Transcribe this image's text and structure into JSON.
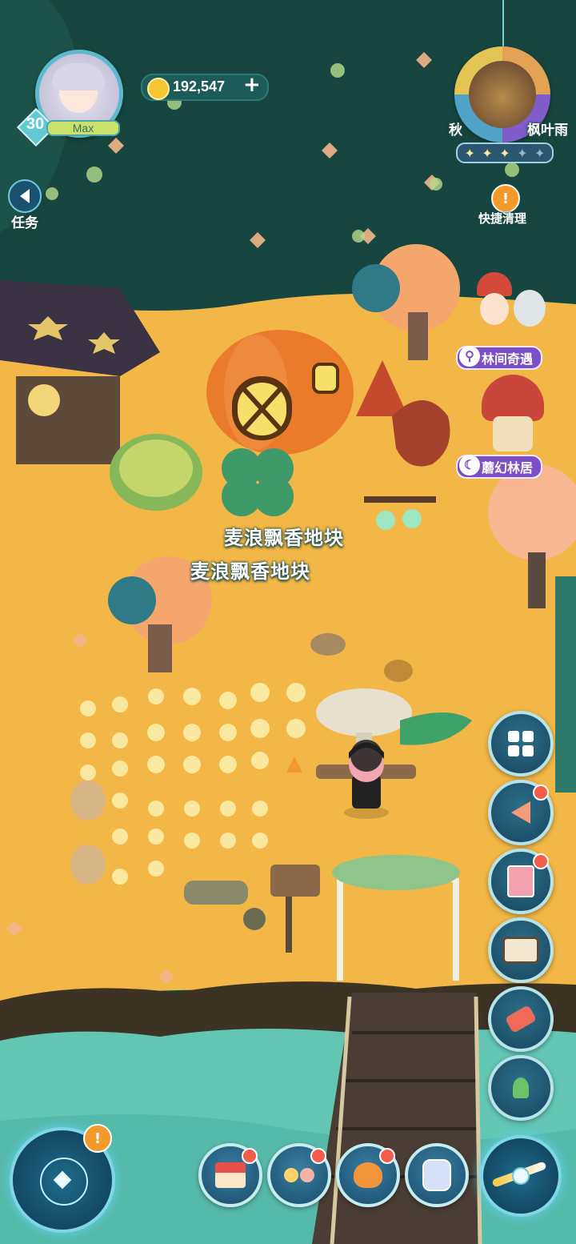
{
  "player": {
    "level": "30",
    "level_tag": "Max"
  },
  "currency": {
    "coins": "192,547",
    "add_label": "+"
  },
  "quest": {
    "label": "任务"
  },
  "season": {
    "season_label": "秋",
    "track_label": "枫叶雨",
    "stars_filled": 3,
    "stars_total": 5
  },
  "quick_clean": {
    "label": "快捷清理",
    "alert": "!"
  },
  "events": {
    "forest_encounter": "林间奇遇",
    "mushroom_home": "蘑幻林居"
  },
  "plot_labels": {
    "primary": "麦浪飘香地块",
    "secondary": "麦浪飘香地块"
  },
  "side_buttons": [
    "catalog-icon",
    "announcement-icon",
    "album-icon",
    "camera-icon",
    "event-hammer-icon",
    "plant-icon"
  ],
  "bottom_buttons": [
    "shop-icon",
    "friends-icon",
    "pet-icon",
    "backpack-icon"
  ],
  "compass": {
    "alert": "!"
  },
  "colors": {
    "sea": "#16463f",
    "sand": "#f2b746",
    "shore": "#62c6b3",
    "accent_purple": "#7d4fc7",
    "badge_red": "#f35e4b"
  }
}
